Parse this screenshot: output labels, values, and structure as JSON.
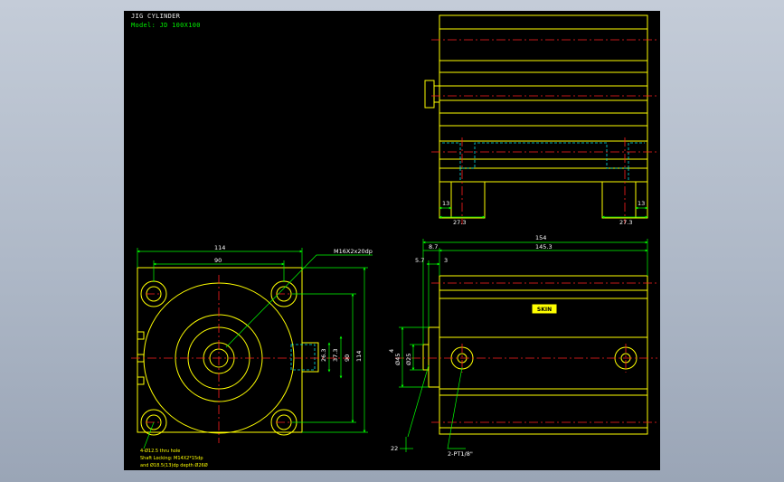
{
  "title": "JIG CYLINDER",
  "model": "Model: JD 100X100",
  "colors": {
    "background": "#000000",
    "outline": "#ffff00",
    "dimension": "#00ff00",
    "centerline": "#ff2020",
    "hidden": "#00e0e0",
    "text": "#ffffff",
    "label": "#ffff00"
  },
  "side_view": {
    "dims": {
      "a": "13",
      "b": "27.3",
      "c": "13",
      "d": "27.3"
    }
  },
  "front_view": {
    "dims": {
      "width": "114",
      "pitch": "90",
      "thread_callout": "M16X2x20dp",
      "d1": "26.3",
      "d2": "37.3",
      "pitch_v": "90",
      "height": "114"
    },
    "notes": [
      "4-Ø12.5 thru hole",
      "Shaft Locking: M14X2*15dp",
      "and Ø18.5(13)dp depth  Ø26Ø"
    ]
  },
  "top_view": {
    "dims": {
      "overall": "154",
      "body": "145.3",
      "rod_len": "8.7",
      "d_a": "5.7",
      "d_b": "3",
      "dia1": "Ø45",
      "dia2": "Ø25",
      "h": "4",
      "bottom": "22",
      "ports": "2-PT1/8\""
    },
    "label": "SKIN"
  }
}
